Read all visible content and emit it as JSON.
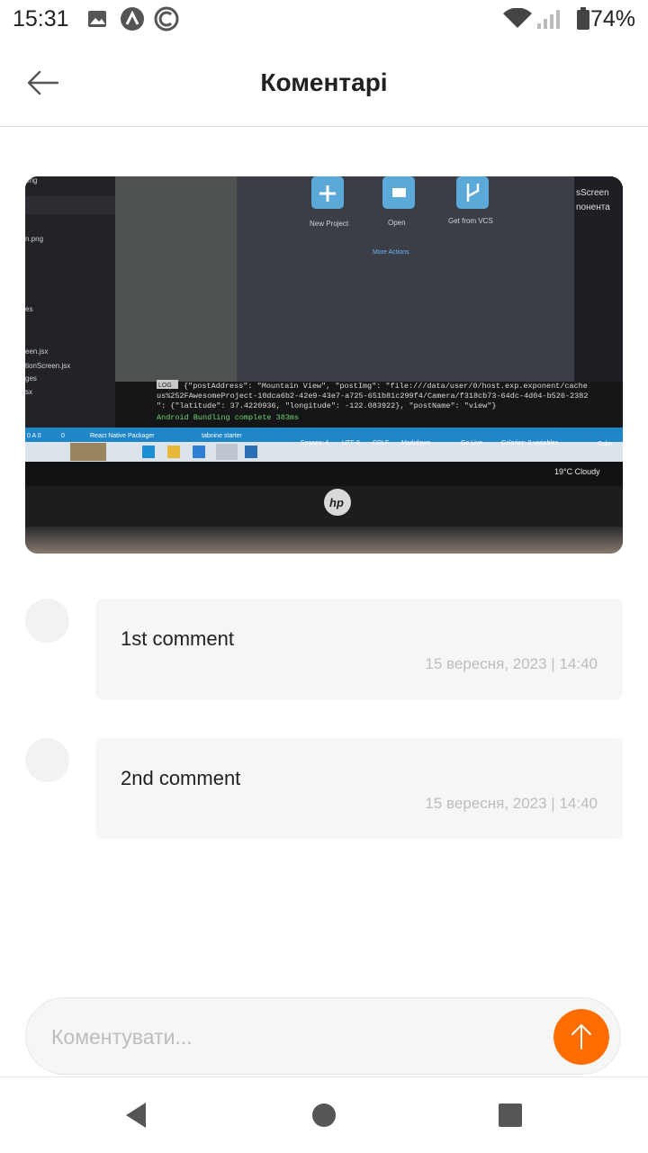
{
  "status_bar": {
    "time": "15:31",
    "battery": "74%",
    "icons": [
      "image-icon",
      "app-a-icon",
      "c-logo-icon",
      "wifi-icon",
      "signal-icon",
      "battery-icon"
    ]
  },
  "header": {
    "title": "Коментарі",
    "back_icon": "arrow-left-icon"
  },
  "photo": {
    "description_icon": "photo-icon",
    "screen_texts": {
      "new_project": "New Project",
      "open": "Open",
      "get_from_vcs": "Get from VCS",
      "more_actions": "More Actions",
      "log_line1": "{\"postAddress\": \"Mountain View\", \"postImg\": \"file:///data/user/0/host.exp.exponent/cache",
      "log_line2": "us%252FAwesomeProject-10dca6b2-42e9-43e7-a725-651b81c299f4/Camera/f318cb73-64dc-4d04-b526-2382",
      "log_line3": "\": {\"latitude\": 37.4220936, \"longitude\": -122.083922}, \"postName\": \"view\"}",
      "log_line4": "Android Bundling complete 383ms",
      "left_files": [
        "png",
        "n.png",
        "es",
        "een.jsx",
        "tionScreen.jsx",
        "ges",
        "sx"
      ],
      "right_top": "sScreen",
      "right_top2": "nонента",
      "statusbar_items": [
        "0 A 0",
        "0",
        "React Native Packager",
        "tabnine starter",
        "Spaces: 4",
        "UTF-8",
        "CRLF",
        "Markdown",
        "Go Live",
        "Colorize: 0 variables",
        "Color"
      ],
      "weather": "19°C  Cloudy",
      "brand": "hp"
    }
  },
  "comments": [
    {
      "text": "1st comment",
      "date": "15 вересня, 2023 | 14:40"
    },
    {
      "text": "2nd comment",
      "date": "15 вересня, 2023 | 14:40"
    }
  ],
  "composer": {
    "placeholder": "Коментувати...",
    "value": "",
    "send_icon": "arrow-up-icon",
    "accent": "#FF6C00"
  },
  "navbar": {
    "icons": [
      "back-triangle-icon",
      "home-circle-icon",
      "recents-square-icon"
    ]
  }
}
